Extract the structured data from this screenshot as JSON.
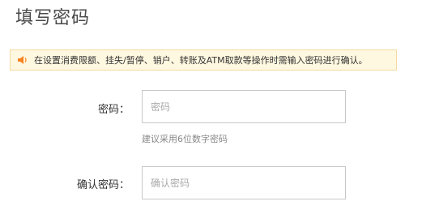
{
  "page": {
    "title": "填写密码"
  },
  "notice": {
    "icon": "speaker-icon",
    "icon_color": "#f5821f",
    "text": "在设置消费限额、挂失/暂停、销户、转账及ATM取款等操作时需输入密码进行确认。"
  },
  "form": {
    "password": {
      "label": "密码：",
      "placeholder": "密码",
      "value": "",
      "hint": "建议采用6位数字密码"
    },
    "confirm_password": {
      "label": "确认密码：",
      "placeholder": "确认密码",
      "value": ""
    }
  }
}
